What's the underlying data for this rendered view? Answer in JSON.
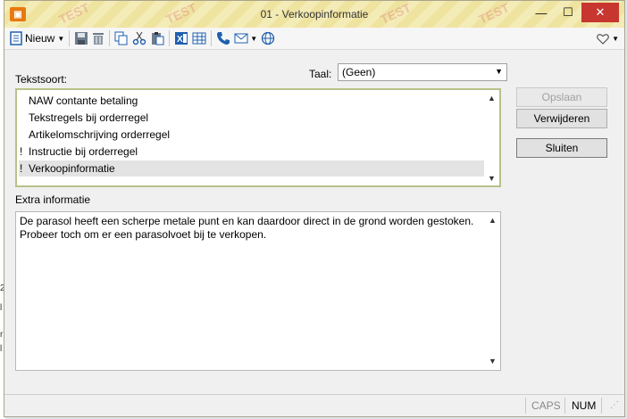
{
  "window": {
    "title": "01 - Verkoopinformatie",
    "watermark": "TEST",
    "buttons": {
      "minimize": "—",
      "maximize": "☐",
      "close": "✕"
    }
  },
  "toolbar": {
    "new_label": "Nieuw",
    "icons": [
      "document-icon",
      "save-icon",
      "delete-icon",
      "copy-icon",
      "cut-icon",
      "paste-icon",
      "excel-icon",
      "table-icon",
      "phone-icon",
      "mail-icon",
      "web-icon",
      "heart-icon"
    ]
  },
  "form": {
    "tekstsoort_label": "Tekstsoort:",
    "taal_label": "Taal:",
    "taal_value": "(Geen)",
    "extra_label": "Extra informatie"
  },
  "list": {
    "items": [
      {
        "mark": "",
        "text": "NAW contante betaling"
      },
      {
        "mark": "",
        "text": "Tekstregels bij orderregel"
      },
      {
        "mark": "",
        "text": "Artikelomschrijving orderregel"
      },
      {
        "mark": "!",
        "text": "Instructie bij orderregel"
      },
      {
        "mark": "!",
        "text": "Verkoopinformatie"
      }
    ],
    "selected_index": 4
  },
  "extra_text": "De parasol heeft een scherpe metale punt en kan daardoor direct in de grond worden gestoken.\nProbeer toch om er een parasolvoet bij te verkopen.",
  "buttons": {
    "opslaan": "Opslaan",
    "verwijderen": "Verwijderen",
    "sluiten": "Sluiten"
  },
  "status": {
    "caps": "CAPS",
    "num": "NUM"
  },
  "colors": {
    "accent": "#1f5fae",
    "close_button": "#c7372f",
    "list_border": "#b7c28a"
  }
}
